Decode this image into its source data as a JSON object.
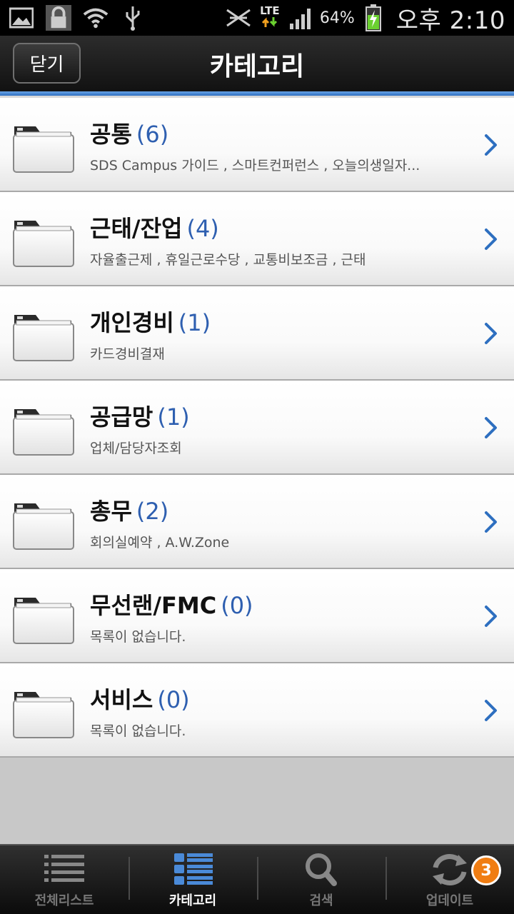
{
  "status_bar": {
    "battery_percent": "64%",
    "time": "오후 2:10",
    "network": "LTE",
    "icons": [
      "image-icon",
      "lock-icon",
      "wifi-icon",
      "usb-icon",
      "no-signal-icon",
      "lte-icon",
      "signal-icon",
      "battery-charging-icon"
    ]
  },
  "header": {
    "close_label": "닫기",
    "title": "카테고리"
  },
  "categories": [
    {
      "name": "공통",
      "count": "(6)",
      "subtitle": "SDS Campus 가이드 , 스마트컨퍼런스 , 오늘의생일자..."
    },
    {
      "name": "근태/잔업",
      "count": "(4)",
      "subtitle": "자율출근제 , 휴일근로수당 , 교통비보조금 , 근태"
    },
    {
      "name": "개인경비",
      "count": "(1)",
      "subtitle": "카드경비결재"
    },
    {
      "name": "공급망",
      "count": "(1)",
      "subtitle": "업체/담당자조회"
    },
    {
      "name": "총무",
      "count": "(2)",
      "subtitle": "회의실예약 , A.W.Zone"
    },
    {
      "name": "무선랜/FMC",
      "count": "(0)",
      "subtitle": "목록이 없습니다."
    },
    {
      "name": "서비스",
      "count": "(0)",
      "subtitle": "목록이 없습니다."
    }
  ],
  "tabs": [
    {
      "label": "전체리스트",
      "icon": "list-icon",
      "active": false
    },
    {
      "label": "카테고리",
      "icon": "category-icon",
      "active": true
    },
    {
      "label": "검색",
      "icon": "search-icon",
      "active": false
    },
    {
      "label": "업데이트",
      "icon": "refresh-icon",
      "active": false,
      "badge": "3"
    }
  ],
  "colors": {
    "accent_blue": "#2e5fb0",
    "header_line": "#4a8ad8",
    "badge_orange": "#f07d12"
  }
}
